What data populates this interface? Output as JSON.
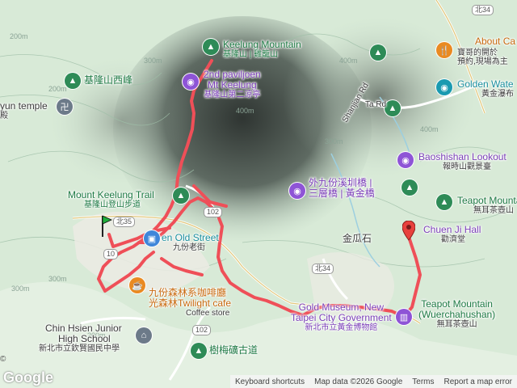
{
  "places": {
    "keelung_mountain": {
      "line1": "Keelung Mountain",
      "line2": "基隆山 | 雞籠山",
      "icon": "park-icon"
    },
    "keelung_west_peak": {
      "line1": "基隆山西峰",
      "icon": "park-icon"
    },
    "second_pavilion": {
      "line1": "2nd paviljoen",
      "line2": "Mt Keelung",
      "line3": "基隆山第二涼亭",
      "icon": "camera-icon"
    },
    "temple": {
      "line1": "yun temple",
      "line2": "殿"
    },
    "trail": {
      "line1": "Mount Keelung Trail",
      "line2": "基隆山登山步道",
      "icon": "park-icon"
    },
    "old_street": {
      "line1": "en Old Street",
      "line2": "九份老街",
      "icon": "bag-icon"
    },
    "forest_cafe": {
      "line1": "九份森林系咖啡廳",
      "line2": "光森林Twilight cafe",
      "line3": "Coffee store",
      "icon": "coffee-icon"
    },
    "school": {
      "line1": "Chin Hsien Junior",
      "line2": "High School",
      "line3": "新北市立欽賢國民中學",
      "icon": "school-icon"
    },
    "shumei_trail": {
      "line1": "樹梅礦古道",
      "icon": "park-icon"
    },
    "outer_bridge": {
      "line1": "外九份溪圳橋 |",
      "line2": "三層橋 | 黃金橋",
      "icon": "camera-icon"
    },
    "jinguashi": {
      "line1": "金瓜石"
    },
    "gold_museum": {
      "line1": "Gold Museum, New",
      "line2": "Taipei City Government",
      "line3": "新北市立黃金博物館",
      "icon": "museum-icon"
    },
    "baoshishan": {
      "line1": "Baoshishan Lookout",
      "line2": "報時山觀景臺",
      "icon": "camera-icon"
    },
    "teapot_1": {
      "line1": "Teapot Mountain",
      "line2": "無耳茶壺山",
      "icon": "park-icon"
    },
    "chuen_ji_hall": {
      "line1": "Chuen Ji Hall",
      "line2": "勸濟堂",
      "icon": "worship-icon"
    },
    "teapot_2": {
      "line1": "Teapot Mountain",
      "line2": "(Wuerchahushan)",
      "line3": "無耳茶壺山"
    },
    "about_cafe": {
      "line1": "About Ca",
      "line2": "寶哥的開於",
      "line3": "預約,現場為主",
      "icon": "food-icon"
    },
    "golden_waterfall": {
      "line1": "Golden Wate",
      "line2": "黃金瀑布",
      "icon": "camera-icon"
    },
    "shanjian_rd": {
      "line1": "Shanjian Rd"
    },
    "ta_rd": {
      "line1": "Ta Rd"
    }
  },
  "roads": [
    "北34",
    "北35",
    "102",
    "102",
    "北34",
    "10"
  ],
  "contours": [
    "200m",
    "200m",
    "300m",
    "300m",
    "300m",
    "400m",
    "400m",
    "300m",
    "400m",
    "200m"
  ],
  "attribution": {
    "google": "Google",
    "copyright": "©",
    "keyboard": "Keyboard shortcuts",
    "mapdata": "Map data ©2026 Google",
    "scale": "",
    "terms": "Terms",
    "report": "Report a map error"
  },
  "colors": {
    "route": "#ef4f58",
    "terrain": "#d8ead7",
    "mountain": "#3a3f3c"
  }
}
